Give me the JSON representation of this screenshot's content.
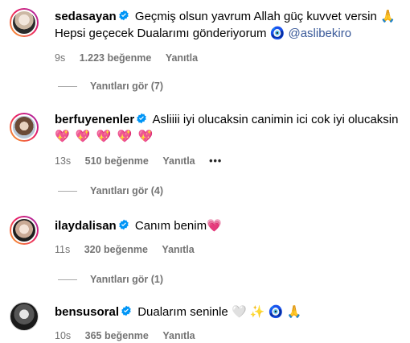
{
  "comments": [
    {
      "username": "sedasayan",
      "text_line1": "Geçmiş olsun yavrum Allah güç kuvvet versin",
      "emoji1": "🙏",
      "text_line2": "Hepsi geçecek Dualarımı gönderiyorum",
      "emoji2": "🧿",
      "mention": "@aslibekiro",
      "time": "9s",
      "likes": "1.223 beğenme",
      "reply": "Yanıtla",
      "view_replies": "Yanıtları gör (7)"
    },
    {
      "username": "berfuyenenler",
      "text_line1": "Asliiii iyi olucaksin canimin ici cok iyi olucaksin",
      "hearts": [
        "💖",
        "💖",
        "💖",
        "💖",
        "💖"
      ],
      "time": "13s",
      "likes": "510 beğenme",
      "reply": "Yanıtla",
      "more": "•••",
      "view_replies": "Yanıtları gör (4)"
    },
    {
      "username": "ilaydalisan",
      "text_line1": "Canım benim",
      "emoji1": "💗",
      "time": "11s",
      "likes": "320 beğenme",
      "reply": "Yanıtla",
      "view_replies": "Yanıtları gör (1)"
    },
    {
      "username": "bensusoral",
      "text_line1": "Dualarım seninle",
      "emojis": [
        "🤍",
        "✨",
        "🧿",
        "🙏"
      ],
      "time": "10s",
      "likes": "365 beğenme",
      "reply": "Yanıtla"
    }
  ],
  "colors": {
    "verified": "#0095f6",
    "mention": "#385898",
    "meta": "#737373",
    "heart": "#e0245e"
  }
}
